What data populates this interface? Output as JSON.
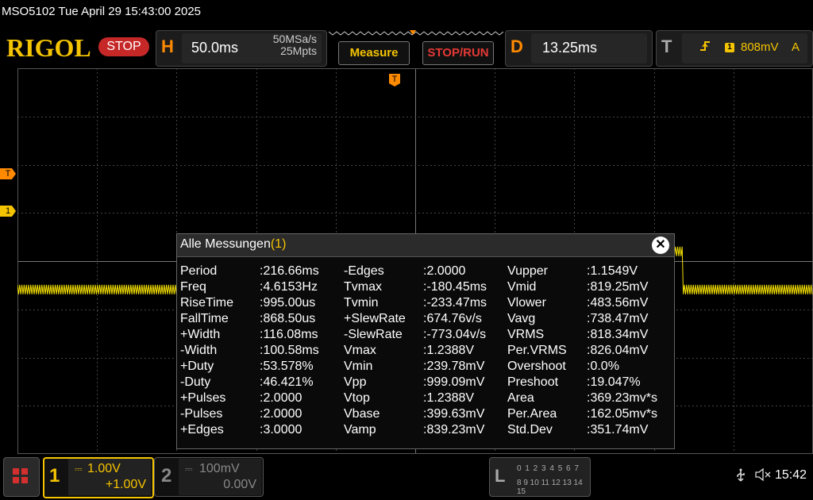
{
  "titlebar": {
    "text": "MSO5102  Tue April 29 15:43:00 2025"
  },
  "brand": {
    "logo": "RIGOL",
    "run_state": "STOP"
  },
  "horizontal": {
    "key": "H",
    "timebase": "50.0ms",
    "sample_rate": "50MSa/s",
    "memory_depth": "25Mpts"
  },
  "buttons": {
    "measure": "Measure",
    "stop_run": "STOP/RUN"
  },
  "delay": {
    "key": "D",
    "value": "13.25ms"
  },
  "trigger": {
    "key": "T",
    "edge_icon": "rising-edge-icon",
    "source": "1",
    "level": "808mV",
    "mode": "A"
  },
  "markers": {
    "trigger_level": "T",
    "channel1": "1",
    "trigger_position": "T"
  },
  "waveform": {
    "color": "#f5e100",
    "high_level_mV": 1200,
    "low_level_mV": 410,
    "transitions_ms": [
      -148,
      -48,
      52,
      168,
      268
    ],
    "initial_state": "low"
  },
  "measurements": {
    "title": "Alle Messungen",
    "count": "(1)",
    "close": "✕",
    "columns": [
      [
        [
          "Period",
          ":216.66ms"
        ],
        [
          "Freq",
          ":4.6153Hz"
        ],
        [
          "RiseTime",
          ":995.00us"
        ],
        [
          "FallTime",
          ":868.50us"
        ],
        [
          "+Width",
          ":116.08ms"
        ],
        [
          "-Width",
          ":100.58ms"
        ],
        [
          "+Duty",
          ":53.578%"
        ],
        [
          "-Duty",
          ":46.421%"
        ],
        [
          "+Pulses",
          ":2.0000"
        ],
        [
          "-Pulses",
          ":2.0000"
        ],
        [
          "+Edges",
          ":3.0000"
        ]
      ],
      [
        [
          "-Edges",
          ":2.0000"
        ],
        [
          "Tvmax",
          ":-180.45ms"
        ],
        [
          "Tvmin",
          ":-233.47ms"
        ],
        [
          "+SlewRate",
          ":674.76v/s"
        ],
        [
          "-SlewRate",
          ":-773.04v/s"
        ],
        [
          "Vmax",
          ":1.2388V"
        ],
        [
          "Vmin",
          ":239.78mV"
        ],
        [
          "Vpp",
          ":999.09mV"
        ],
        [
          "Vtop",
          ":1.2388V"
        ],
        [
          "Vbase",
          ":399.63mV"
        ],
        [
          "Vamp",
          ":839.23mV"
        ]
      ],
      [
        [
          "Vupper",
          ":1.1549V"
        ],
        [
          "Vmid",
          ":819.25mV"
        ],
        [
          "Vlower",
          ":483.56mV"
        ],
        [
          "Vavg",
          ":738.47mV"
        ],
        [
          "VRMS",
          ":818.34mV"
        ],
        [
          "Per.VRMS",
          ":826.04mV"
        ],
        [
          "Overshoot",
          ":0.0%"
        ],
        [
          "Preshoot",
          ":19.047%"
        ],
        [
          "Area",
          ":369.23mv*s"
        ],
        [
          "Per.Area",
          ":162.05mv*s"
        ],
        [
          "Std.Dev",
          ":351.74mV"
        ]
      ]
    ]
  },
  "channel1": {
    "number": "1",
    "scale": "1.00V",
    "offset": "+1.00V",
    "coupling_icon": "dc-coupling-icon",
    "color": "#f5c400"
  },
  "channel2": {
    "number": "2",
    "scale": "100mV",
    "offset": "0.00V",
    "coupling_icon": "dc-coupling-icon"
  },
  "logic": {
    "key": "L",
    "row1": "0 1 2 3   4 5 6 7",
    "row2": "8  9 10 11  12 13 14 15"
  },
  "status": {
    "usb_icon": "usb-icon",
    "speaker_icon": "speaker-muted-icon",
    "time": "15:42"
  }
}
